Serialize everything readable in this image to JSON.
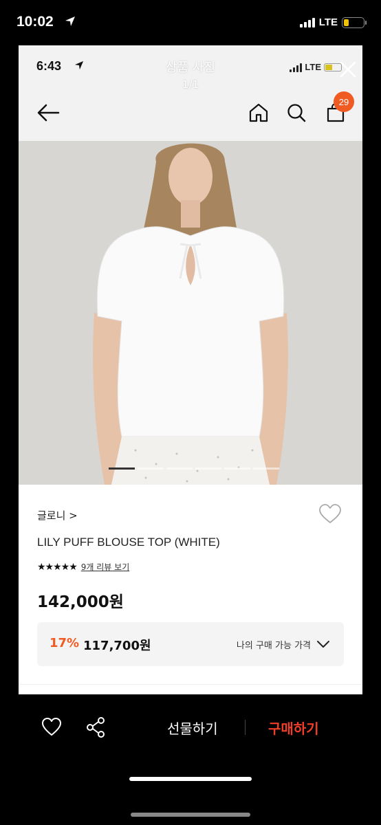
{
  "outer_status": {
    "time": "10:02",
    "network": "LTE",
    "battery_level": 0.25
  },
  "inner_status": {
    "time": "6:43",
    "network": "LTE",
    "battery_level": 0.45
  },
  "viewer": {
    "title": "상품 사진",
    "counter": "1/1"
  },
  "header": {
    "cart_count": "29"
  },
  "product": {
    "brand": "글로니 >",
    "name": "LILY PUFF BLOUSE TOP (WHITE)",
    "stars": "★★★★★",
    "rating_value": 4.5,
    "review_link": "9개 리뷰 보기",
    "price": "142,000원",
    "discount_percent": "17%",
    "discount_price": "117,700원",
    "my_price_label": "나의 구매 가능 가격"
  },
  "image_pager": {
    "pages": 6,
    "active": 1
  },
  "bottom": {
    "gift_label": "선물하기",
    "buy_label": "구매하기"
  },
  "colors": {
    "accent": "#ef5b22",
    "buy": "#ef3f2a"
  }
}
